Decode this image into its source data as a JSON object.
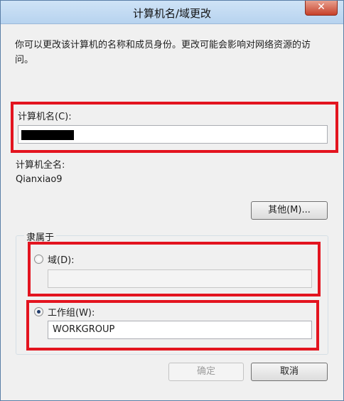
{
  "window": {
    "title": "计算机名/域更改",
    "close_glyph": "✕"
  },
  "description": "你可以更改该计算机的名称和成员身份。更改可能会影响对网络资源的访问。",
  "computer_name": {
    "label": "计算机名(C):",
    "value": ""
  },
  "full_name": {
    "label": "计算机全名:",
    "value": "Qianxiao9"
  },
  "other_button": "其他(M)...",
  "member_of": {
    "group_label": "隶属于",
    "domain": {
      "label": "域(D):",
      "value": "",
      "selected": false,
      "enabled": false
    },
    "workgroup": {
      "label": "工作组(W):",
      "value": "WORKGROUP",
      "selected": true
    }
  },
  "ok_button": "确定",
  "cancel_button": "取消",
  "colors": {
    "highlight": "#e3141f",
    "titlebar": "#b7d3ef"
  }
}
